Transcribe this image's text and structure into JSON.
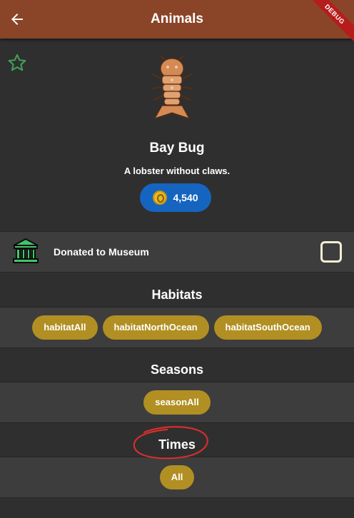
{
  "app_bar": {
    "title": "Animals",
    "debug_label": "DEBUG"
  },
  "critter": {
    "name": "Bay Bug",
    "description": "A lobster without claws.",
    "price": "4,540"
  },
  "museum": {
    "label": "Donated to Museum",
    "checked": false
  },
  "habitats": {
    "title": "Habitats",
    "chips": [
      "habitatAll",
      "habitatNorthOcean",
      "habitatSouthOcean"
    ]
  },
  "seasons": {
    "title": "Seasons",
    "chips": [
      "seasonAll"
    ]
  },
  "times": {
    "title": "Times",
    "chips": [
      "All"
    ]
  },
  "icons": {
    "back": "arrow-left-icon",
    "favorite": "star-outline-icon",
    "coin": "coin-icon",
    "museum": "museum-icon"
  },
  "colors": {
    "app_bar": "#8a4427",
    "price_pill": "#1565c0",
    "chip": "#b18f23",
    "favorite_star": "#3fa058",
    "annotation_circle": "#d32f2f"
  }
}
